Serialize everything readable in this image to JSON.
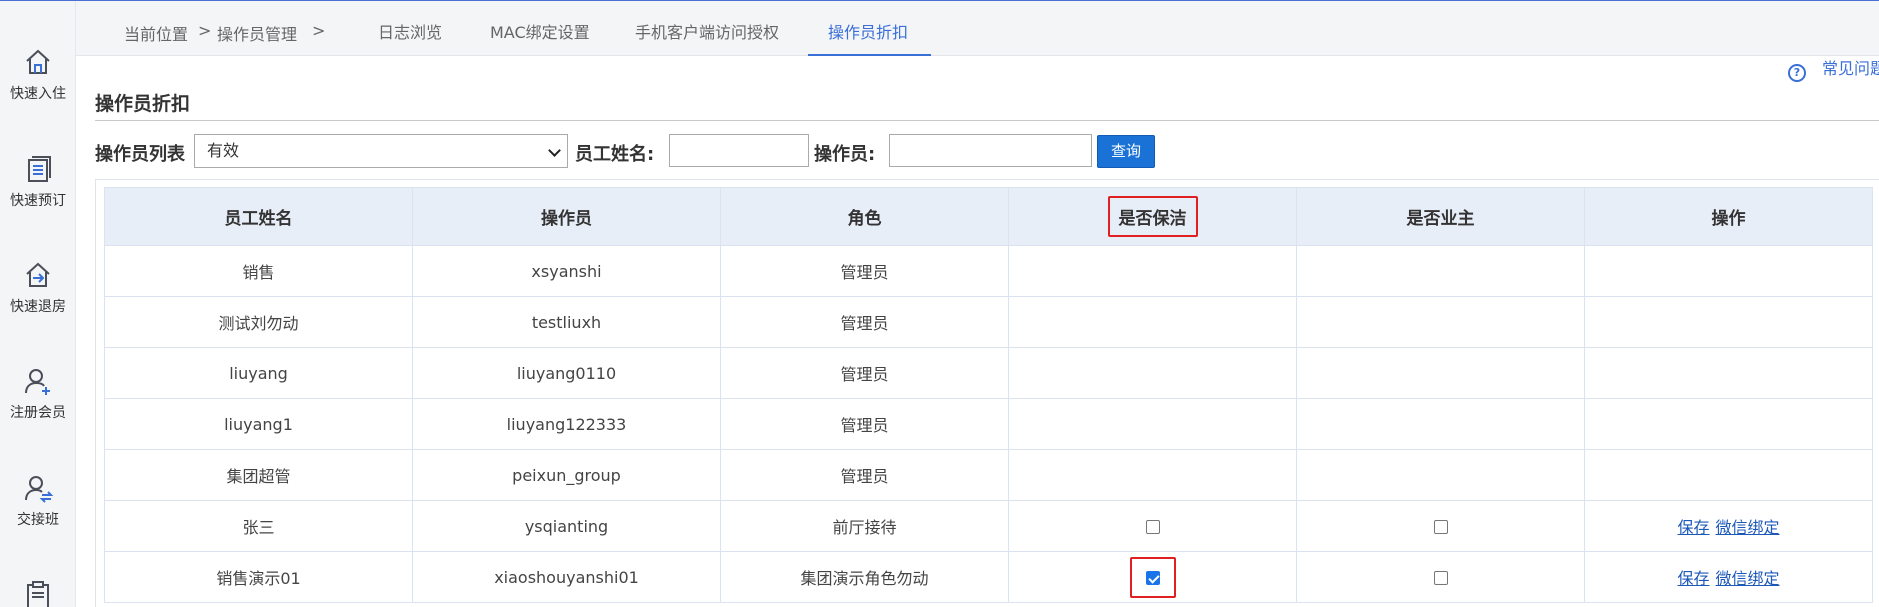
{
  "sidebar": {
    "items": [
      {
        "label": "快速入住",
        "icon": "home-icon"
      },
      {
        "label": "快速预订",
        "icon": "booking-list-icon"
      },
      {
        "label": "快速退房",
        "icon": "checkout-icon"
      },
      {
        "label": "注册会员",
        "icon": "add-member-icon"
      },
      {
        "label": "交接班",
        "icon": "shift-handover-icon"
      },
      {
        "label": "",
        "icon": "report-icon"
      }
    ]
  },
  "breadcrumb": {
    "current_position": "当前位置",
    "sep1": ">",
    "section": "操作员管理",
    "sep2": ">"
  },
  "tabs": [
    {
      "label": "日志浏览",
      "active": false
    },
    {
      "label": "MAC绑定设置",
      "active": false
    },
    {
      "label": "手机客户端访问授权",
      "active": false
    },
    {
      "label": "操作员折扣",
      "active": true
    }
  ],
  "faq": {
    "icon": "question-circle-icon",
    "label": "常见问题"
  },
  "page": {
    "title": "操作员折扣"
  },
  "filter": {
    "operator_list_label": "操作员列表",
    "status_selected": "有效",
    "employee_name_label": "员工姓名:",
    "employee_name_value": "",
    "operator_label": "操作员:",
    "operator_value": "",
    "query_button": "查询"
  },
  "table": {
    "headers": [
      "员工姓名",
      "操作员",
      "角色",
      "是否保洁",
      "是否业主",
      "操作"
    ],
    "rows": [
      {
        "name": "销售",
        "operator": "xsyanshi",
        "role": "管理员",
        "editable": false
      },
      {
        "name": "测试刘勿动",
        "operator": "testliuxh",
        "role": "管理员",
        "editable": false
      },
      {
        "name": "liuyang",
        "operator": "liuyang0110",
        "role": "管理员",
        "editable": false
      },
      {
        "name": "liuyang1",
        "operator": "liuyang122333",
        "role": "管理员",
        "editable": false
      },
      {
        "name": "集团超管",
        "operator": "peixun_group",
        "role": "管理员",
        "editable": false
      },
      {
        "name": "张三",
        "operator": "ysqianting",
        "role": "前厅接待",
        "editable": true,
        "cleaner": false,
        "owner": false,
        "save": "保存",
        "wechat": "微信绑定"
      },
      {
        "name": "销售演示01",
        "operator": "xiaoshouyanshi01",
        "role": "集团演示角色勿动",
        "editable": true,
        "cleaner": true,
        "owner": false,
        "save": "保存",
        "wechat": "微信绑定"
      }
    ]
  },
  "colors": {
    "accent": "#3a6fd8",
    "highlight": "#e02020",
    "button": "#1a72d6"
  }
}
